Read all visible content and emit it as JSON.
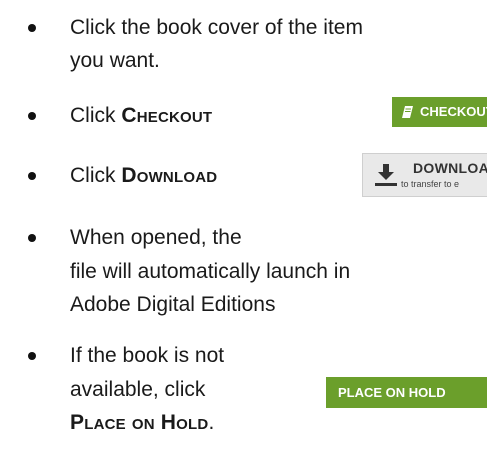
{
  "steps": [
    {
      "lines": [
        "Click the book cover of the item",
        "you want."
      ]
    },
    {
      "prefix": "Click ",
      "emphasis": "Checkout"
    },
    {
      "prefix": "Click ",
      "emphasis": "Download"
    },
    {
      "lines": [
        "When opened, the",
        "file will automatically launch in",
        "Adobe Digital Editions"
      ]
    },
    {
      "lines": [
        "If the book is not",
        "available, click"
      ],
      "emphasis": "Place on Hold",
      "suffix": "."
    }
  ],
  "buttons": {
    "checkout": {
      "label": "CHECKOUT",
      "icon": "book-icon",
      "color": "#6b9f2b"
    },
    "download": {
      "label": "DOWNLOAD",
      "sublabel": "to transfer to e",
      "icon": "download-arrow-icon",
      "color": "#e9e9e9"
    },
    "place_on_hold": {
      "label": "PLACE ON HOLD",
      "color": "#6b9f2b"
    }
  }
}
